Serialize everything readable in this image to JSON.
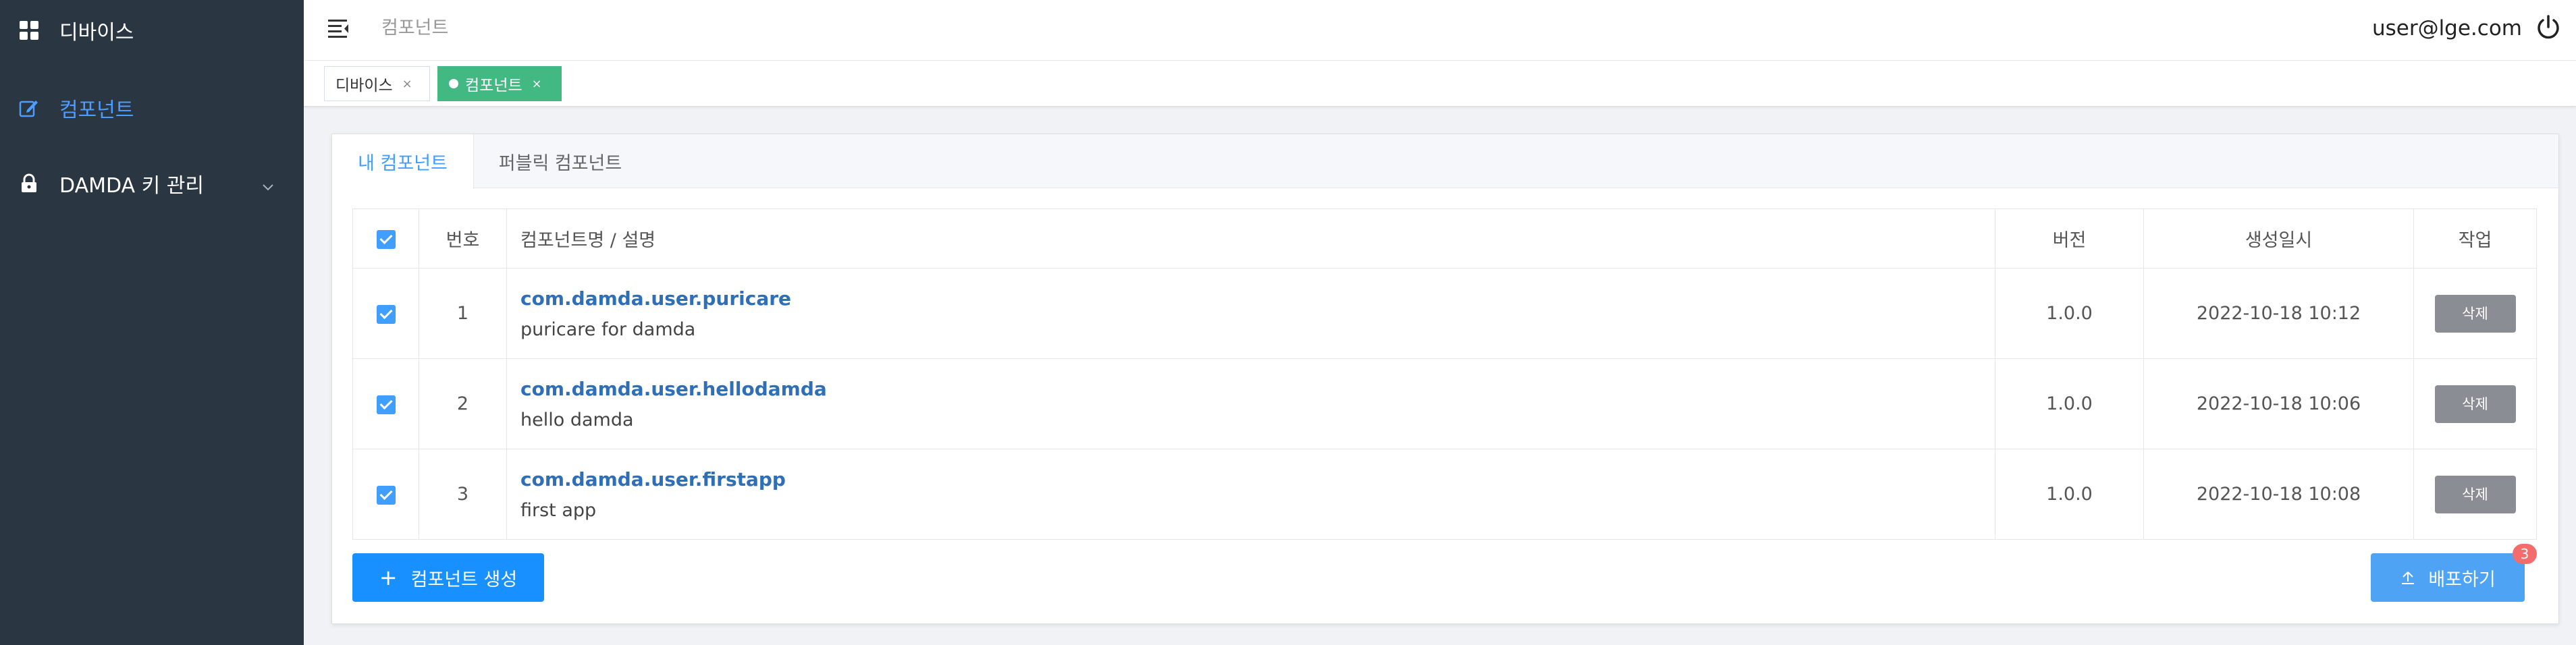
{
  "sidebar": {
    "items": [
      {
        "label": "디바이스",
        "icon": "grid-icon"
      },
      {
        "label": "컴포넌트",
        "icon": "edit-icon",
        "active": true
      },
      {
        "label": "DAMDA 키 관리",
        "icon": "lock-icon",
        "expandable": true
      }
    ]
  },
  "header": {
    "breadcrumb": "컴포넌트",
    "user": "user@lge.com"
  },
  "page_tabs": [
    {
      "label": "디바이스",
      "close": "×"
    },
    {
      "label": "컴포넌트",
      "close": "×",
      "active": true
    }
  ],
  "card": {
    "tabs": [
      {
        "label": "내 컴포넌트",
        "active": true
      },
      {
        "label": "퍼블릭 컴포넌트"
      }
    ],
    "table": {
      "headers": {
        "no": "번호",
        "name": "컴포넌트명 / 설명",
        "version": "버전",
        "created": "생성일시",
        "action": "작업"
      },
      "rows": [
        {
          "no": "1",
          "name": "com.damda.user.puricare",
          "desc": "puricare for damda",
          "version": "1.0.0",
          "created": "2022-10-18 10:12",
          "action": "삭제",
          "checked": true
        },
        {
          "no": "2",
          "name": "com.damda.user.hellodamda",
          "desc": "hello damda",
          "version": "1.0.0",
          "created": "2022-10-18 10:06",
          "action": "삭제",
          "checked": true
        },
        {
          "no": "3",
          "name": "com.damda.user.firstapp",
          "desc": "first app",
          "version": "1.0.0",
          "created": "2022-10-18 10:08",
          "action": "삭제",
          "checked": true
        }
      ]
    },
    "create_button": "컴포넌트 생성",
    "deploy_button": "배포하기",
    "deploy_badge": "3"
  },
  "colors": {
    "sidebar_bg": "#2b3643",
    "accent": "#409eff",
    "active_tab": "#42b983",
    "badge": "#f56c6c"
  }
}
